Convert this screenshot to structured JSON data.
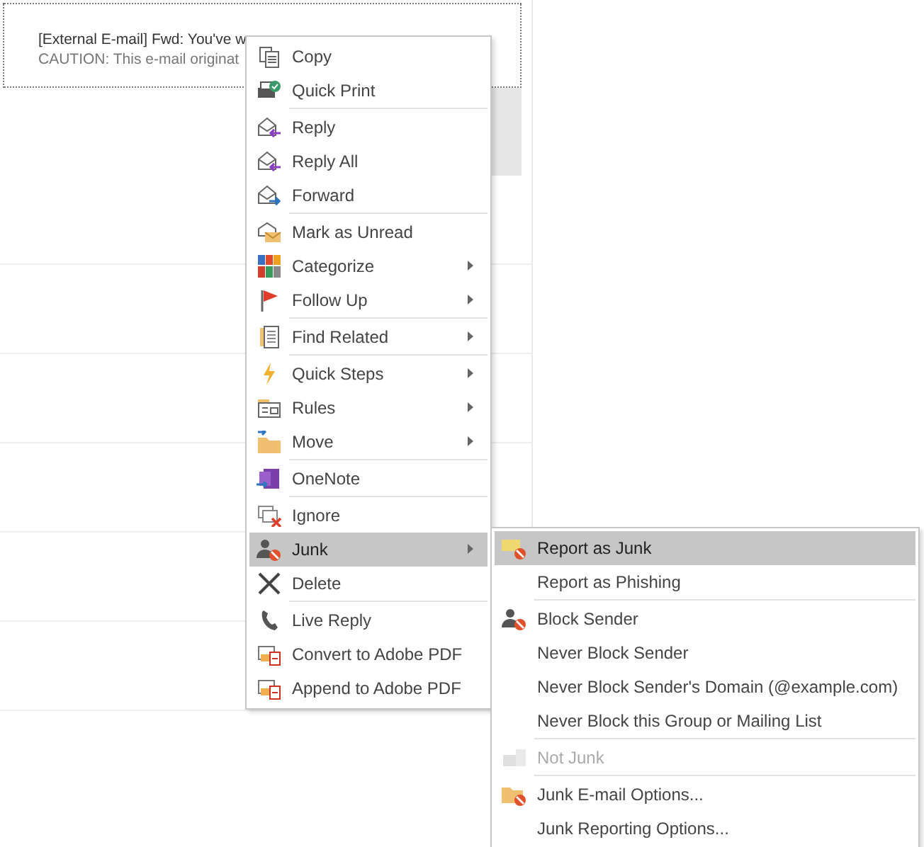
{
  "message": {
    "subject": "[External E-mail] Fwd: You've w",
    "preview": "CAUTION: This e-mail originat"
  },
  "context_menu": {
    "items": [
      {
        "kind": "item",
        "label": "Copy",
        "submenu": false,
        "selected": false
      },
      {
        "kind": "item",
        "label": "Quick Print",
        "submenu": false,
        "selected": false
      },
      {
        "kind": "separator"
      },
      {
        "kind": "item",
        "label": "Reply",
        "submenu": false,
        "selected": false
      },
      {
        "kind": "item",
        "label": "Reply All",
        "submenu": false,
        "selected": false
      },
      {
        "kind": "item",
        "label": "Forward",
        "submenu": false,
        "selected": false
      },
      {
        "kind": "separator"
      },
      {
        "kind": "item",
        "label": "Mark as Unread",
        "submenu": false,
        "selected": false
      },
      {
        "kind": "item",
        "label": "Categorize",
        "submenu": true,
        "selected": false
      },
      {
        "kind": "item",
        "label": "Follow Up",
        "submenu": true,
        "selected": false
      },
      {
        "kind": "separator"
      },
      {
        "kind": "item",
        "label": "Find Related",
        "submenu": true,
        "selected": false
      },
      {
        "kind": "separator"
      },
      {
        "kind": "item",
        "label": "Quick Steps",
        "submenu": true,
        "selected": false
      },
      {
        "kind": "item",
        "label": "Rules",
        "submenu": true,
        "selected": false
      },
      {
        "kind": "item",
        "label": "Move",
        "submenu": true,
        "selected": false
      },
      {
        "kind": "separator"
      },
      {
        "kind": "item",
        "label": "OneNote",
        "submenu": false,
        "selected": false
      },
      {
        "kind": "separator"
      },
      {
        "kind": "item",
        "label": "Ignore",
        "submenu": false,
        "selected": false
      },
      {
        "kind": "item",
        "label": "Junk",
        "submenu": true,
        "selected": true
      },
      {
        "kind": "item",
        "label": "Delete",
        "submenu": false,
        "selected": false
      },
      {
        "kind": "separator"
      },
      {
        "kind": "item",
        "label": "Live Reply",
        "submenu": false,
        "selected": false
      },
      {
        "kind": "item",
        "label": "Convert to Adobe PDF",
        "submenu": false,
        "selected": false
      },
      {
        "kind": "item",
        "label": "Append to Adobe PDF",
        "submenu": false,
        "selected": false
      }
    ]
  },
  "junk_submenu": {
    "items": [
      {
        "kind": "item",
        "label": "Report as Junk",
        "selected": true,
        "disabled": false
      },
      {
        "kind": "item",
        "label": "Report as Phishing",
        "selected": false,
        "disabled": false
      },
      {
        "kind": "separator"
      },
      {
        "kind": "item",
        "label": "Block Sender",
        "selected": false,
        "disabled": false
      },
      {
        "kind": "item",
        "label": "Never Block Sender",
        "selected": false,
        "disabled": false
      },
      {
        "kind": "item",
        "label": "Never Block Sender's Domain (@example.com)",
        "selected": false,
        "disabled": false
      },
      {
        "kind": "item",
        "label": "Never Block this Group or Mailing List",
        "selected": false,
        "disabled": false
      },
      {
        "kind": "separator"
      },
      {
        "kind": "item",
        "label": "Not Junk",
        "selected": false,
        "disabled": true
      },
      {
        "kind": "separator"
      },
      {
        "kind": "item",
        "label": "Junk E-mail Options...",
        "selected": false,
        "disabled": false
      },
      {
        "kind": "item",
        "label": "Junk Reporting Options...",
        "selected": false,
        "disabled": false
      }
    ]
  }
}
